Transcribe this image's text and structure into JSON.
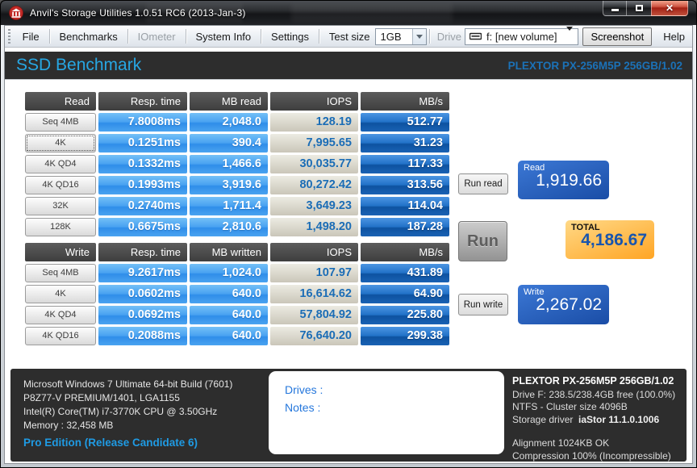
{
  "window": {
    "title": "Anvil's Storage Utilities 1.0.51 RC6 (2013-Jan-3)"
  },
  "menu": {
    "file": "File",
    "benchmarks": "Benchmarks",
    "iometer": "IOmeter",
    "system_info": "System Info",
    "settings": "Settings",
    "test_size_label": "Test size",
    "test_size_value": "1GB",
    "drive_label": "Drive",
    "drive_value": "f: [new volume]",
    "screenshot": "Screenshot",
    "help": "Help"
  },
  "header": {
    "title": "SSD Benchmark",
    "device": "PLEXTOR PX-256M5P 256GB/1.02"
  },
  "read_table": {
    "headers": [
      "Read",
      "Resp. time",
      "MB read",
      "IOPS",
      "MB/s"
    ],
    "rows": [
      {
        "label": "Seq 4MB",
        "resp": "7.8008ms",
        "mb": "2,048.0",
        "iops": "128.19",
        "mbs": "512.77"
      },
      {
        "label": "4K",
        "resp": "0.1251ms",
        "mb": "390.4",
        "iops": "7,995.65",
        "mbs": "31.23"
      },
      {
        "label": "4K QD4",
        "resp": "0.1332ms",
        "mb": "1,466.6",
        "iops": "30,035.77",
        "mbs": "117.33"
      },
      {
        "label": "4K QD16",
        "resp": "0.1993ms",
        "mb": "3,919.6",
        "iops": "80,272.42",
        "mbs": "313.56"
      },
      {
        "label": "32K",
        "resp": "0.2740ms",
        "mb": "1,711.4",
        "iops": "3,649.23",
        "mbs": "114.04"
      },
      {
        "label": "128K",
        "resp": "0.6675ms",
        "mb": "2,810.6",
        "iops": "1,498.20",
        "mbs": "187.28"
      }
    ]
  },
  "write_table": {
    "headers": [
      "Write",
      "Resp. time",
      "MB written",
      "IOPS",
      "MB/s"
    ],
    "rows": [
      {
        "label": "Seq 4MB",
        "resp": "9.2617ms",
        "mb": "1,024.0",
        "iops": "107.97",
        "mbs": "431.89"
      },
      {
        "label": "4K",
        "resp": "0.0602ms",
        "mb": "640.0",
        "iops": "16,614.62",
        "mbs": "64.90"
      },
      {
        "label": "4K QD4",
        "resp": "0.0692ms",
        "mb": "640.0",
        "iops": "57,804.92",
        "mbs": "225.80"
      },
      {
        "label": "4K QD16",
        "resp": "0.2088ms",
        "mb": "640.0",
        "iops": "76,640.20",
        "mbs": "299.38"
      }
    ]
  },
  "actions": {
    "run_read": "Run read",
    "run": "Run",
    "run_write": "Run write"
  },
  "scores": {
    "read_label": "Read",
    "read_value": "1,919.66",
    "total_label": "TOTAL",
    "total_value": "4,186.67",
    "write_label": "Write",
    "write_value": "2,267.02"
  },
  "system_info": {
    "line1": "Microsoft Windows 7 Ultimate  64-bit Build (7601)",
    "line2": "P8Z77-V PREMIUM/1401, LGA1155",
    "line3": "Intel(R) Core(TM) i7-3770K CPU @ 3.50GHz",
    "line4": "Memory : 32,458 MB",
    "edition": "Pro Edition (Release Candidate 6)"
  },
  "notes_box": {
    "drives_label": "Drives :",
    "notes_label": "Notes :"
  },
  "drive_info": {
    "title": "PLEXTOR PX-256M5P 256GB/1.02",
    "line1": "Drive F: 238.5/238.4GB free (100.0%)",
    "line2": "NTFS - Cluster size 4096B",
    "storage_driver_label": "Storage driver",
    "storage_driver_value": "iaStor 11.1.0.1006",
    "line4": "Alignment 1024KB OK",
    "line5": "Compression 100% (Incompressible)"
  },
  "colors": {
    "band_bg": "#2d2d2d",
    "ssd_title": "#27a7e3",
    "device_blue": "#1b72b8",
    "cell_blue": "#49a2f1",
    "cell_navy": "#0d52a0",
    "cell_beige": "#d6d2c6",
    "iops_text": "#1b6db6",
    "score_blue": "#1a4da6",
    "total_orange": "#ffa524",
    "total_value": "#1855ae",
    "edition_blue": "#1f9be4",
    "notes_blue": "#2577dc",
    "close_red": "#a32114"
  }
}
